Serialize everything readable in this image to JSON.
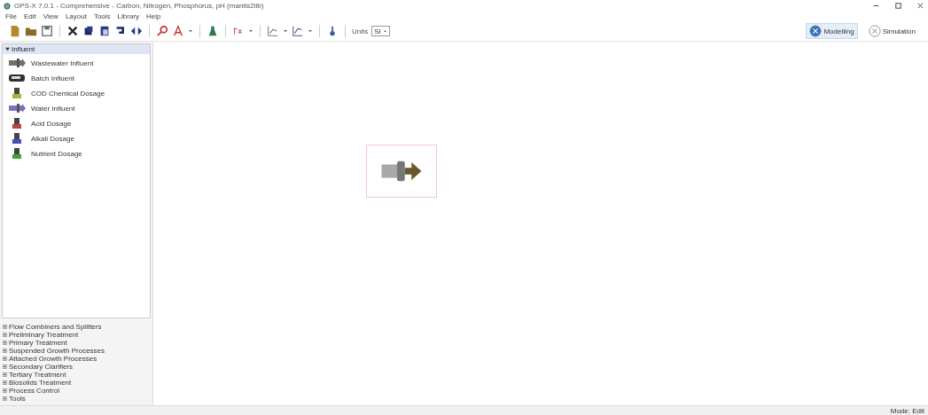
{
  "window": {
    "title": "GPS-X 7.0.1 - Comprehensive - Carbon, Nitrogen, Phosphorus, pH (mantis2lib)"
  },
  "menu": [
    "File",
    "Edit",
    "View",
    "Layout",
    "Tools",
    "Library",
    "Help"
  ],
  "toolbar": {
    "units_label": "Units",
    "units_value": "SI"
  },
  "modes": [
    {
      "label": "Modelling",
      "selected": true
    },
    {
      "label": "Simulation",
      "selected": false
    }
  ],
  "sidebar": {
    "group": "Influent",
    "expanded": true,
    "items": [
      {
        "label": "Wastewater Influent",
        "kind": "pipe",
        "color": "#707070"
      },
      {
        "label": "Batch Influent",
        "kind": "tank",
        "color": "#303030"
      },
      {
        "label": "COD Chemical Dosage",
        "kind": "dose",
        "color": "#b0b030"
      },
      {
        "label": "Water Influent",
        "kind": "pipe",
        "color": "#8070c0"
      },
      {
        "label": "Acid Dosage",
        "kind": "dose",
        "color": "#c04040"
      },
      {
        "label": "Alkali Dosage",
        "kind": "dose",
        "color": "#4050c0"
      },
      {
        "label": "Nutrient Dosage",
        "kind": "dose",
        "color": "#40a040"
      }
    ],
    "categories": [
      {
        "label": "Flow Combiners and Splitters",
        "expanded": false
      },
      {
        "label": "Preliminary Treatment",
        "expanded": false
      },
      {
        "label": "Primary Treatment",
        "expanded": false
      },
      {
        "label": "Suspended Growth Processes",
        "expanded": false
      },
      {
        "label": "Attached Growth Processes",
        "expanded": false
      },
      {
        "label": "Secondary Clarifiers",
        "expanded": false
      },
      {
        "label": "Tertiary Treatment",
        "expanded": false
      },
      {
        "label": "Biosolids Treatment",
        "expanded": false
      },
      {
        "label": "Process Control",
        "expanded": false
      },
      {
        "label": "Tools",
        "expanded": false
      }
    ]
  },
  "status_bar": {
    "mode": "Mode: Edit"
  }
}
